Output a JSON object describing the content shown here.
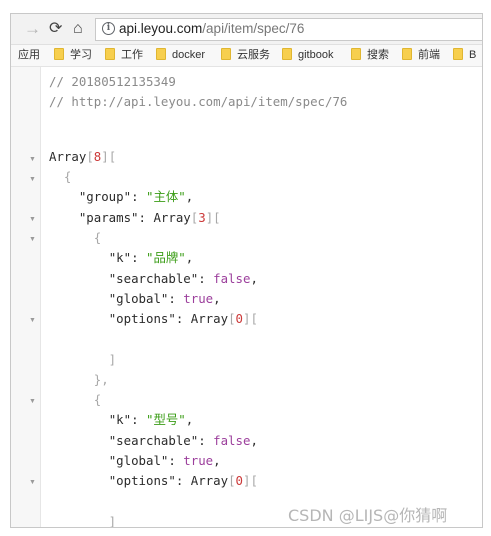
{
  "browser": {
    "back_icon": "back-arrow-icon",
    "reload_icon": "reload-icon",
    "home_icon": "home-icon",
    "info_icon": "info-icon",
    "url_host": "api.leyou.com",
    "url_path": "/api/item/spec/76"
  },
  "bookmarks": {
    "apps_label": "应用",
    "items": [
      {
        "label": "学习"
      },
      {
        "label": "工作"
      },
      {
        "label": "docker"
      },
      {
        "label": "云服务"
      },
      {
        "label": "gitbook"
      },
      {
        "label": "搜索"
      },
      {
        "label": "前端"
      },
      {
        "label": "B"
      }
    ],
    "folder_color": "#f7cf4e"
  },
  "code": {
    "comment_timestamp": "// 20180512135349",
    "comment_url": "// http://api.leyou.com/api/item/spec/76",
    "array_keyword": "Array",
    "outer_count": "8",
    "group_key": "\"group\"",
    "group_value": "\"主体\"",
    "params_key": "\"params\"",
    "params_count": "3",
    "k_key": "\"k\"",
    "searchable_key": "\"searchable\"",
    "global_key": "\"global\"",
    "options_key": "\"options\"",
    "options_count": "0",
    "false_value": "false",
    "true_value": "true",
    "item1_k": "\"品牌\"",
    "item2_k": "\"型号\""
  },
  "colors": {
    "string": "#3b9d17",
    "keyword": "#9c3f9c",
    "number": "#cc3939",
    "comment": "#8a8a8a"
  },
  "watermark": "CSDN @LIJS@你猜啊"
}
